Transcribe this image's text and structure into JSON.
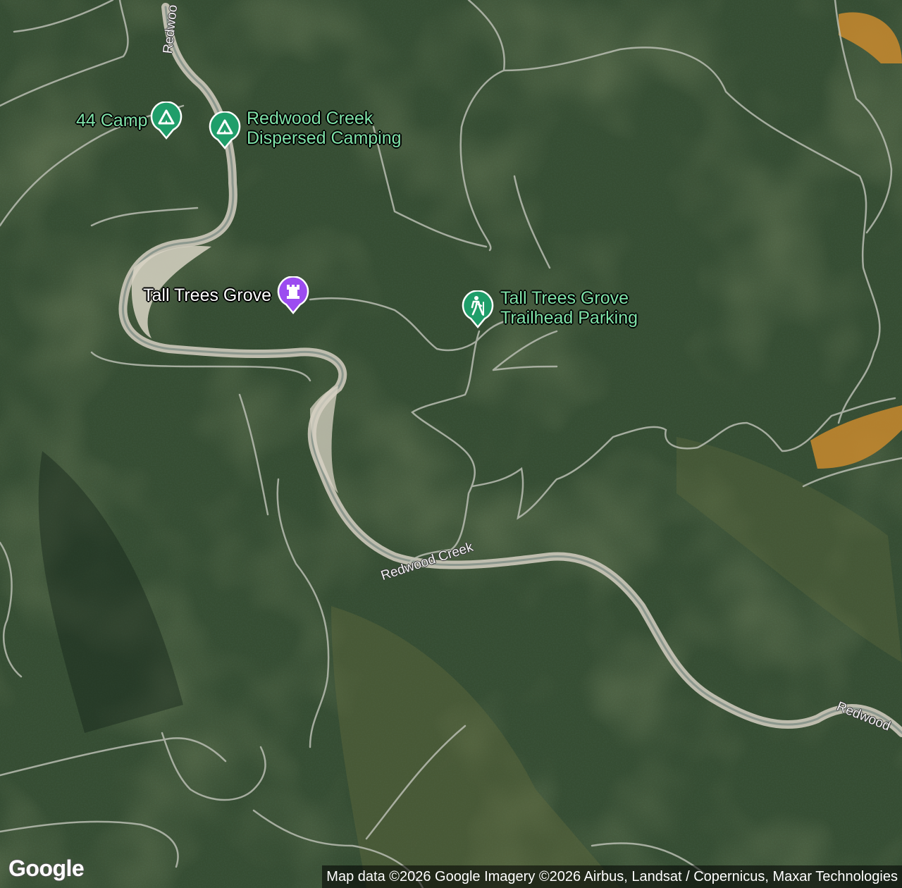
{
  "map": {
    "type": "satellite",
    "colors": {
      "forest_dark": "#223424",
      "forest_mid": "#3a5234",
      "forest_light": "#5b6a40",
      "riverbed": "#cfcbbe",
      "trail": "#b9bdb2",
      "bare_ground": "#c98a2e",
      "pin_green": "#1f9e6a",
      "pin_purple": "#9c4cf0"
    }
  },
  "pois": [
    {
      "name": "44 Camp",
      "icon": "campground-icon",
      "color": "#1f9e6a"
    },
    {
      "name": "Redwood Creek\nDispersed Camping",
      "line1": "Redwood Creek",
      "line2": "Dispersed Camping",
      "icon": "campground-icon",
      "color": "#1f9e6a"
    },
    {
      "name": "Tall Trees Grove",
      "icon": "landmark-icon",
      "color": "#9c4cf0"
    },
    {
      "name": "Tall Trees Grove\nTrailhead Parking",
      "line1": "Tall Trees Grove",
      "line2": "Trailhead Parking",
      "icon": "hiker-icon",
      "color": "#1f9e6a"
    }
  ],
  "road_labels": [
    "Redwoo",
    "Redwood Creek",
    "Redwood"
  ],
  "footer": {
    "logo": "Google",
    "attribution": "Map data ©2026 Google Imagery ©2026 Airbus, Landsat / Copernicus, Maxar Technologies"
  }
}
